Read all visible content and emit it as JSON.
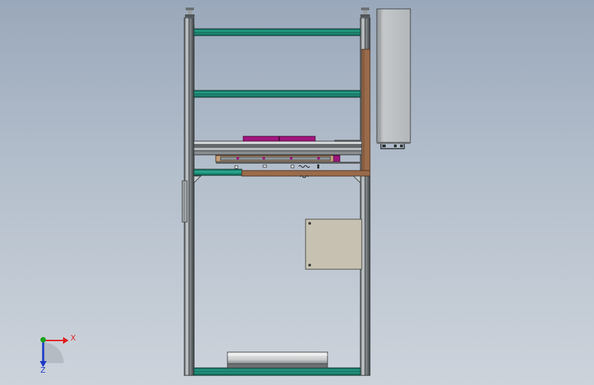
{
  "viewport": {
    "background_top": "#9aa8bb",
    "background_bottom": "#cdd3db"
  },
  "colors": {
    "frame_gray": "#8e9294",
    "frame_dark": "#3e4345",
    "frame_light": "#c9cdcf",
    "teal_rail": "#1f8f7a",
    "brown_plate": "#9a6b4a",
    "tan_panel": "#c6c1b1",
    "magenta": "#a0167e",
    "cabinet_gray": "#b8bcbe",
    "tray_light": "#dcdede",
    "axis_x": "#e21c1c",
    "axis_y": "#1aa21a",
    "axis_z": "#1c39c6"
  },
  "triad": {
    "x_label": "X",
    "z_label": "Z",
    "icon": "coordinate-triad-icon"
  }
}
